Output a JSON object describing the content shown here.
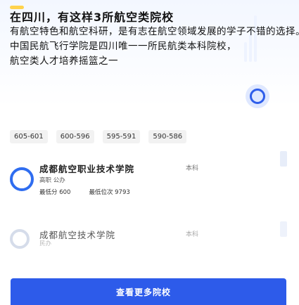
{
  "headline": {
    "title": "在四川，有这样3所航空类院校",
    "lines": [
      "有航空特色和航空科研，是有志在航空领域发展的学子不错的选择。",
      "中国民航飞行学院是四川唯一一所民航类本科院校，",
      "航空类人才培养摇篮之一"
    ]
  },
  "scores": [
    "605-601",
    "600-596",
    "595-591",
    "590-586"
  ],
  "schools": [
    {
      "name": "成都航空职业技术学院",
      "type": "本科",
      "tags": "高职 公办",
      "meta": [
        "最低分 600",
        "最低位次 9793"
      ]
    },
    {
      "name": "成都航空技术学院",
      "type": "本科",
      "tags": "民办",
      "meta": []
    }
  ],
  "bottom": {
    "label": "查看更多院校"
  }
}
